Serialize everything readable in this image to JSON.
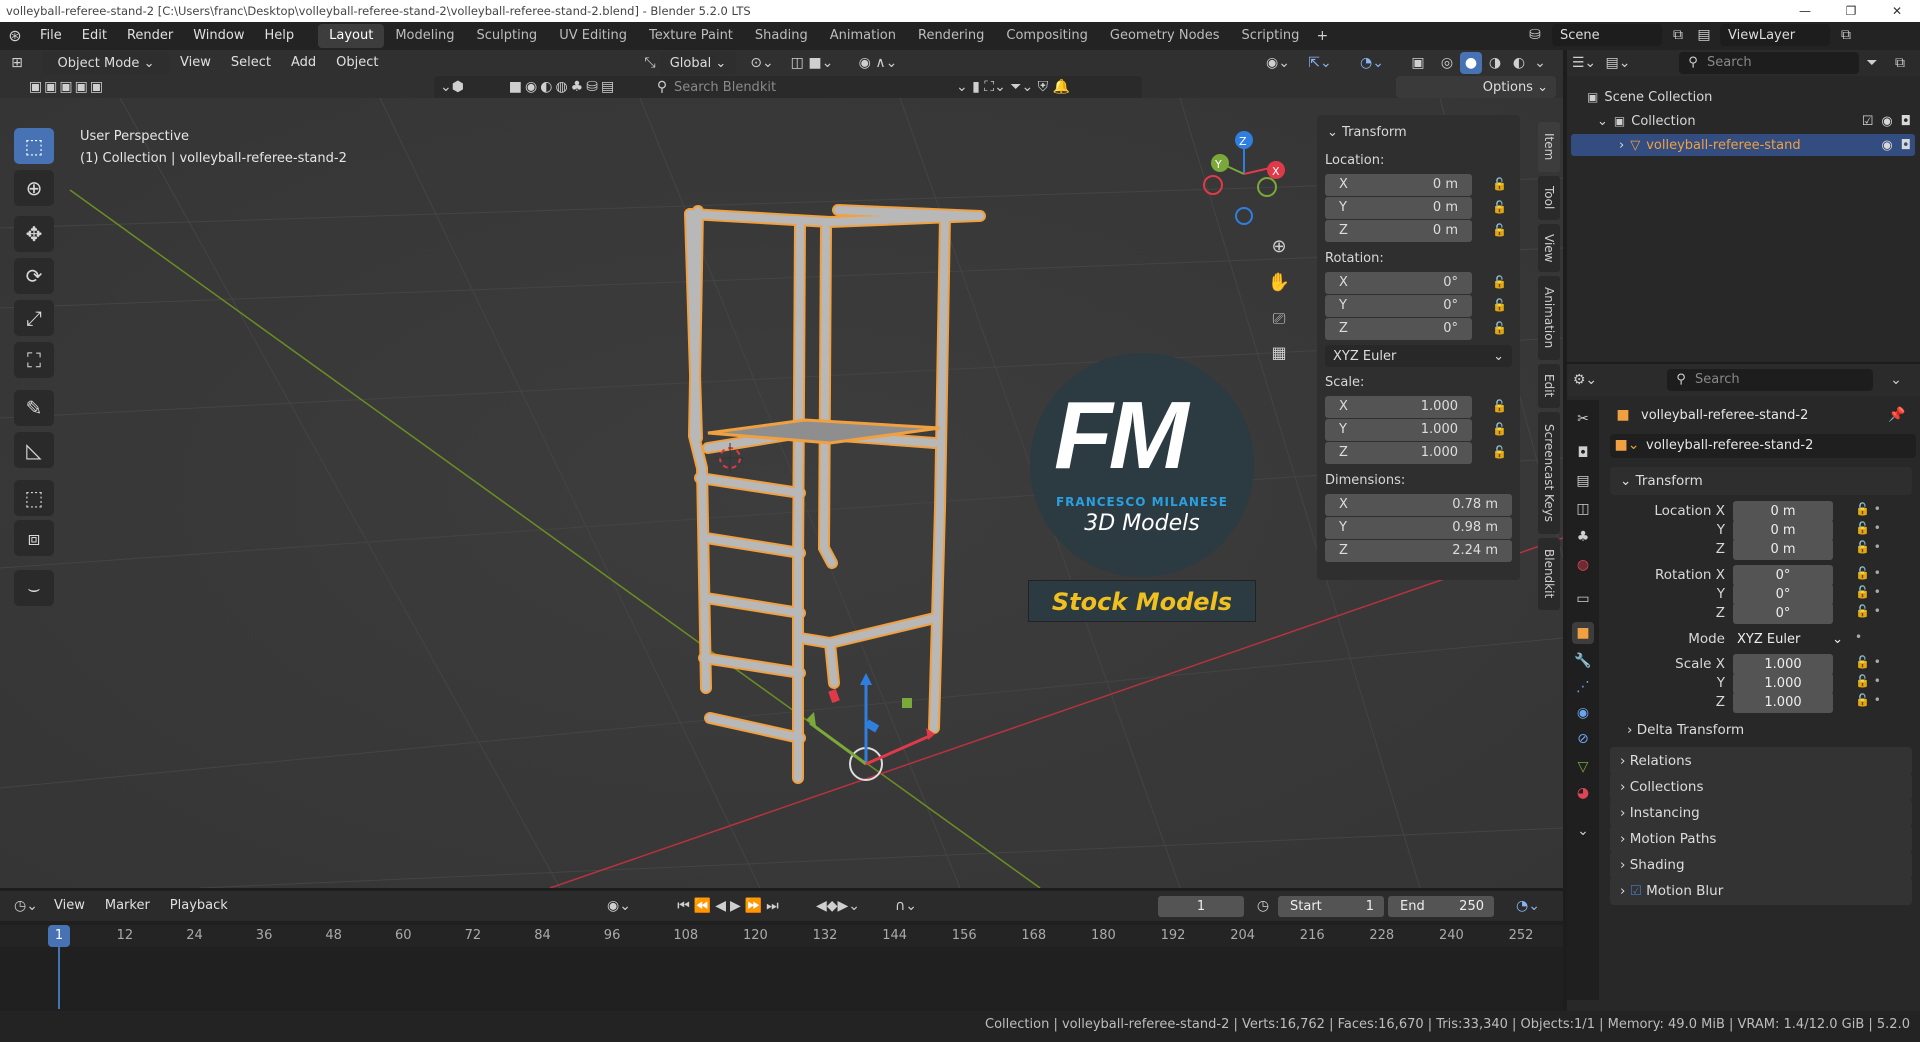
{
  "titlebar": {
    "text": "volleyball-referee-stand-2 [C:\\Users\\franc\\Desktop\\volleyball-referee-stand-2\\volleyball-referee-stand-2.blend] - Blender 5.2.0 LTS"
  },
  "topbar": {
    "menus": [
      "File",
      "Edit",
      "Render",
      "Window",
      "Help"
    ],
    "workspaces": [
      "Layout",
      "Modeling",
      "Sculpting",
      "UV Editing",
      "Texture Paint",
      "Shading",
      "Animation",
      "Rendering",
      "Compositing",
      "Geometry Nodes",
      "Scripting"
    ],
    "scene": "Scene",
    "view_layer": "ViewLayer"
  },
  "viewport_header": {
    "mode": "Object Mode",
    "menus": [
      "View",
      "Select",
      "Add",
      "Object"
    ],
    "orientation": "Global",
    "search_placeholder": "Search Blendkit",
    "options": "Options"
  },
  "viewport": {
    "perspective": "User Perspective",
    "collection": "(1) Collection | volleyball-referee-stand-2",
    "watermark_initials": "FM",
    "watermark_name": "FRANCESCO MILANESE",
    "watermark_sub": "3D Models",
    "watermark_banner": "Stock Models"
  },
  "npanel": {
    "title": "Transform",
    "location_label": "Location:",
    "location": [
      {
        "axis": "X",
        "value": "0 m"
      },
      {
        "axis": "Y",
        "value": "0 m"
      },
      {
        "axis": "Z",
        "value": "0 m"
      }
    ],
    "rotation_label": "Rotation:",
    "rotation": [
      {
        "axis": "X",
        "value": "0°"
      },
      {
        "axis": "Y",
        "value": "0°"
      },
      {
        "axis": "Z",
        "value": "0°"
      }
    ],
    "rotation_mode": "XYZ Euler",
    "scale_label": "Scale:",
    "scale": [
      {
        "axis": "X",
        "value": "1.000"
      },
      {
        "axis": "Y",
        "value": "1.000"
      },
      {
        "axis": "Z",
        "value": "1.000"
      }
    ],
    "dimensions_label": "Dimensions:",
    "dimensions": [
      {
        "axis": "X",
        "value": "0.78 m"
      },
      {
        "axis": "Y",
        "value": "0.98 m"
      },
      {
        "axis": "Z",
        "value": "2.24 m"
      }
    ],
    "tabs": [
      "Item",
      "Tool",
      "View",
      "Animation",
      "Edit",
      "Screencast Keys",
      "Blendkit"
    ]
  },
  "outliner": {
    "search_placeholder": "Search",
    "scene_collection": "Scene Collection",
    "collection": "Collection",
    "object": "volleyball-referee-stand"
  },
  "properties": {
    "search_placeholder": "Search",
    "object_name": "volleyball-referee-stand-2",
    "data_name": "volleyball-referee-stand-2",
    "transform_title": "Transform",
    "location_x_label": "Location X",
    "y_label": "Y",
    "z_label": "Z",
    "location": [
      "0 m",
      "0 m",
      "0 m"
    ],
    "rotation_x_label": "Rotation X",
    "rotation": [
      "0°",
      "0°",
      "0°"
    ],
    "mode_label": "Mode",
    "mode": "XYZ Euler",
    "scale_x_label": "Scale X",
    "scale": [
      "1.000",
      "1.000",
      "1.000"
    ],
    "delta_transform": "Delta Transform",
    "panels": [
      "Relations",
      "Collections",
      "Instancing",
      "Motion Paths",
      "Shading",
      "Motion Blur"
    ]
  },
  "timeline": {
    "menus": [
      "View",
      "Marker",
      "Playback"
    ],
    "current_frame": "1",
    "start_label": "Start",
    "start": "1",
    "end_label": "End",
    "end": "250",
    "frame_ticks": [
      "1",
      "12",
      "24",
      "36",
      "48",
      "60",
      "72",
      "84",
      "96",
      "108",
      "120",
      "132",
      "144",
      "156",
      "168",
      "180",
      "192",
      "204",
      "216",
      "228",
      "240",
      "252"
    ]
  },
  "statusbar": {
    "text": "Collection | volleyball-referee-stand-2 | Verts:16,762 | Faces:16,670 | Tris:33,340 | Objects:1/1 | Memory: 49.0 MiB | VRAM: 1.4/12.0 GiB | 5.2.0"
  },
  "colors": {
    "accent": "#4772b3",
    "selection_orange": "#f0a040",
    "x_axis": "#e03a4a",
    "y_axis": "#7aa83a",
    "z_axis": "#2f7fe0"
  }
}
